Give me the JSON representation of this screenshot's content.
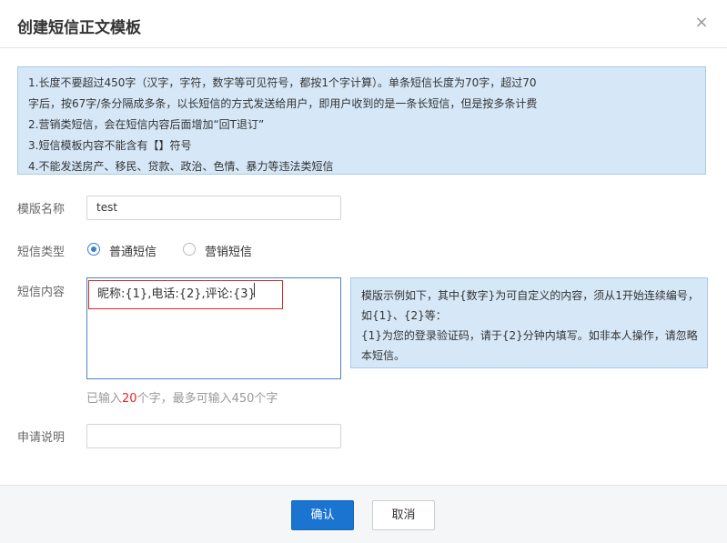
{
  "dialog": {
    "title": "创建短信正文模板",
    "close_glyph": "×"
  },
  "notice": {
    "lines": [
      "1.长度不要超过450字（汉字，字符，数字等可见符号，都按1个字计算）。单条短信长度为70字，超过70",
      "字后，按67字/条分隔成多条，以长短信的方式发送给用户，即用户收到的是一条长短信，但是按多条计费",
      "2.营销类短信，会在短信内容后面增加“回T退订”",
      "3.短信模板内容不能含有【】符号",
      "4.不能发送房产、移民、贷款、政治、色情、暴力等违法类短信"
    ]
  },
  "form": {
    "template_name": {
      "label": "模版名称",
      "value": "test"
    },
    "sms_type": {
      "label": "短信类型",
      "options": [
        {
          "label": "普通短信",
          "checked": true
        },
        {
          "label": "营销短信",
          "checked": false
        }
      ]
    },
    "sms_content": {
      "label": "短信内容",
      "value": "昵称:{1},电话:{2},评论:{3}",
      "counter_prefix": "已输入",
      "counter_value": "20",
      "counter_suffix": "个字，最多可输入450个字"
    },
    "example": {
      "lines": [
        "模版示例如下，其中{数字}为可自定义的内容，须从1开始连续编号，",
        "如{1}、{2}等：",
        "{1}为您的登录验证码，请于{2}分钟内填写。如非本人操作，请忽略",
        "本短信。"
      ]
    },
    "application_note": {
      "label": "申请说明",
      "value": ""
    }
  },
  "footer": {
    "confirm_label": "确认",
    "cancel_label": "取消"
  },
  "colors": {
    "primary": "#1a74d0",
    "notice_bg": "#d6e8f8",
    "highlight_red": "#e0281f"
  }
}
